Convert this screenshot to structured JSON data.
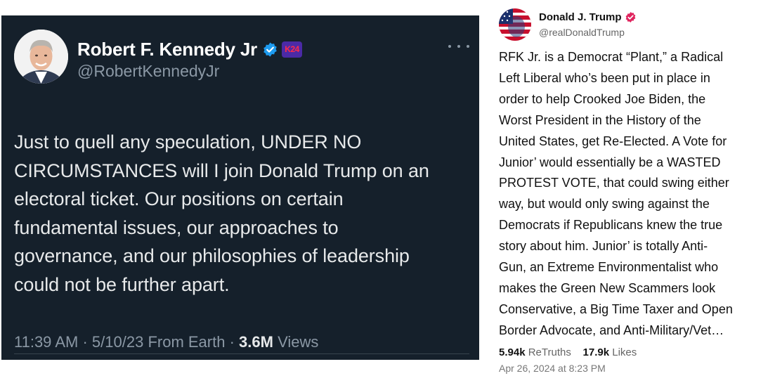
{
  "x_post": {
    "author_name": "Robert F. Kennedy Jr",
    "handle": "@RobertKennedyJr",
    "affiliate_badge": "K24",
    "verified_icon": "verified-check-icon",
    "more_icon": "more-options-icon",
    "text": "Just to quell any speculation, UNDER NO\nCIRCUMSTANCES will I join Donald Trump on an\nelectoral ticket. Our positions on certain\nfundamental issues, our approaches to\ngovernance, and our philosophies of leadership\ncould not be further apart.",
    "time": "11:39 AM",
    "date": "5/10/23",
    "source": "From Earth",
    "sep": "·",
    "views_count": "3.6M",
    "views_label": "Views",
    "colors": {
      "background": "#15202b",
      "text": "#e7e9ea",
      "muted": "#8b98a5",
      "verified": "#1d9bf0"
    }
  },
  "truth_post": {
    "author_name": "Donald J. Trump",
    "handle": "@realDonaldTrump",
    "verified_icon": "verified-badge-icon",
    "text": "RFK Jr. is a Democrat “Plant,” a Radical\nLeft Liberal who’s been put in place in\norder to help Crooked Joe Biden, the\nWorst President in the History of the\nUnited States, get Re-Elected. A Vote for\nJunior’ would essentially be a WASTED\nPROTEST VOTE, that could swing either\nway, but would only swing against the\nDemocrats if Republicans knew the true\nstory about him. Junior’ is totally Anti-\nGun, an Extreme Environmentalist who\nmakes the Green New Scammers look\nConservative, a Big Time Taxer and Open\nBorder Advocate, and Anti-Military/Vet…",
    "retruths_count": "5.94k",
    "retruths_label": "ReTruths",
    "likes_count": "17.9k",
    "likes_label": "Likes",
    "date": "Apr 26, 2024 at 8:23 PM",
    "colors": {
      "verified": "#e0245e",
      "text": "#111111",
      "muted": "#666666"
    }
  }
}
